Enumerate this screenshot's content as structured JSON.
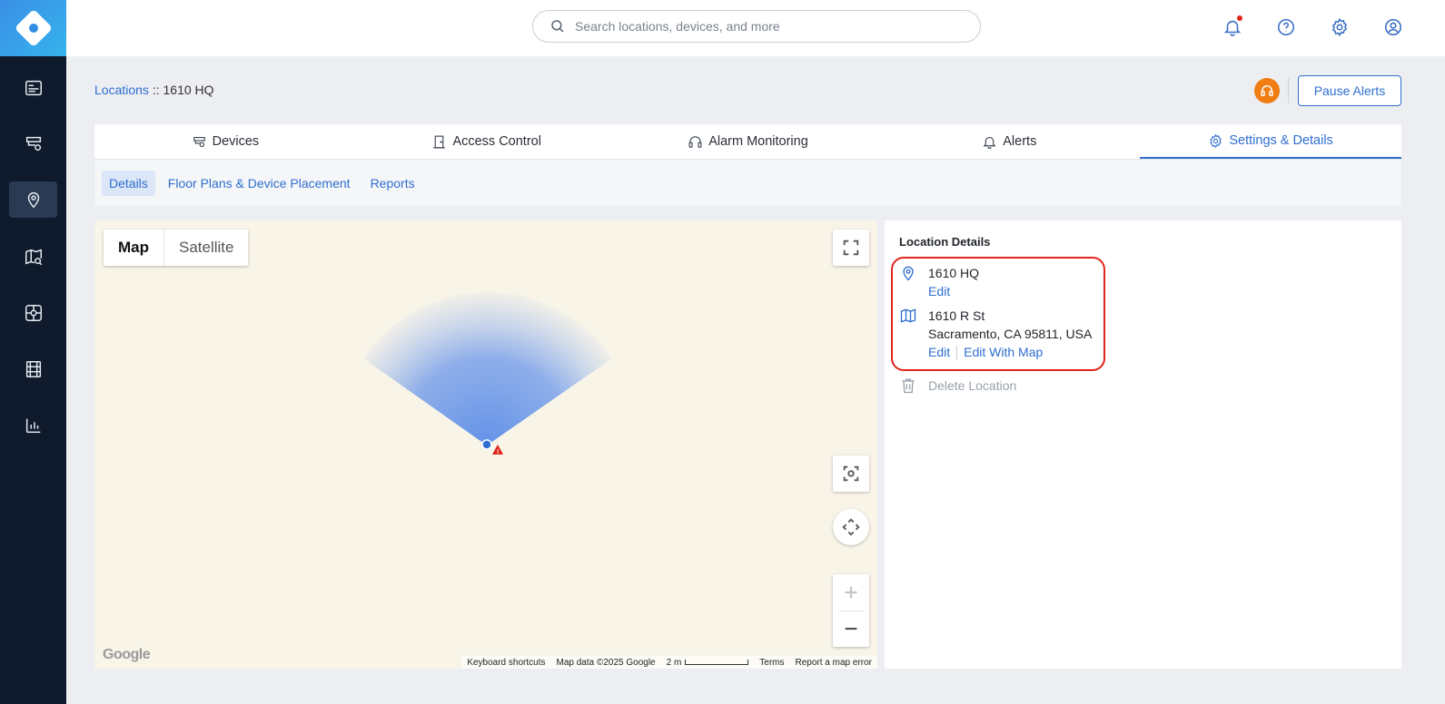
{
  "search": {
    "placeholder": "Search locations, devices, and more"
  },
  "breadcrumb": {
    "root": "Locations",
    "separator": " :: ",
    "current": "1610 HQ"
  },
  "header": {
    "pause_alerts": "Pause Alerts"
  },
  "tabs": [
    {
      "label": "Devices",
      "icon": "camera-icon"
    },
    {
      "label": "Access Control",
      "icon": "door-icon"
    },
    {
      "label": "Alarm Monitoring",
      "icon": "headset-icon"
    },
    {
      "label": "Alerts",
      "icon": "bell-icon"
    },
    {
      "label": "Settings & Details",
      "icon": "gear-icon",
      "active": true
    }
  ],
  "subtabs": [
    {
      "label": "Details",
      "active": true
    },
    {
      "label": "Floor Plans & Device Placement"
    },
    {
      "label": "Reports"
    }
  ],
  "map": {
    "type_map": "Map",
    "type_satellite": "Satellite",
    "google": "Google",
    "footer": {
      "shortcuts": "Keyboard shortcuts",
      "data": "Map data ©2025 Google",
      "scale": "2 m",
      "terms": "Terms",
      "report": "Report a map error"
    }
  },
  "details": {
    "title": "Location Details",
    "name": "1610 HQ",
    "edit": "Edit",
    "address_line1": "1610 R St",
    "address_line2": "Sacramento, CA 95811, USA",
    "edit_with_map": "Edit With Map",
    "delete": "Delete Location"
  },
  "colors": {
    "accent": "#2f6fd1",
    "nav_bg": "#0f1b2d",
    "highlight": "#e0251b",
    "support": "#f07d12"
  }
}
